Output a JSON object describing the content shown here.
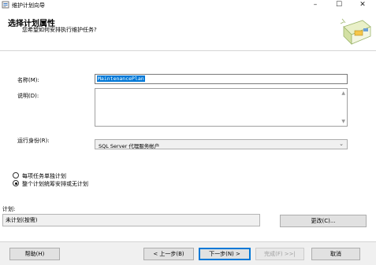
{
  "window": {
    "title": "维护计划向导",
    "minimize_glyph": "–",
    "maximize_glyph": "☐",
    "close_glyph": "✕"
  },
  "header": {
    "title": "选择计划属性",
    "subtitle": "您希望如何安排执行维护任务?"
  },
  "form": {
    "name_label": "名称(M):",
    "name_value": "MaintenancePlan",
    "description_label": "说明(D):",
    "description_value": "",
    "run_as_label": "运行身份(R):",
    "run_as_value": "SQL Server 代理服务帐户",
    "radio_separate": "每项任务单独计划",
    "radio_single": "整个计划统筹安排或无计划",
    "radio_selected": "single",
    "schedule_label": "计划:",
    "schedule_value": "未计划(按需)",
    "change_button": "更改(C)..."
  },
  "footer": {
    "help": "帮助(H)",
    "back": "< 上一步(B)",
    "next": "下一步(N) >",
    "finish": "完成(F) >>|",
    "cancel": "取消"
  },
  "colors": {
    "accent": "#0078d7",
    "footer_bg": "#f0f0f0"
  }
}
